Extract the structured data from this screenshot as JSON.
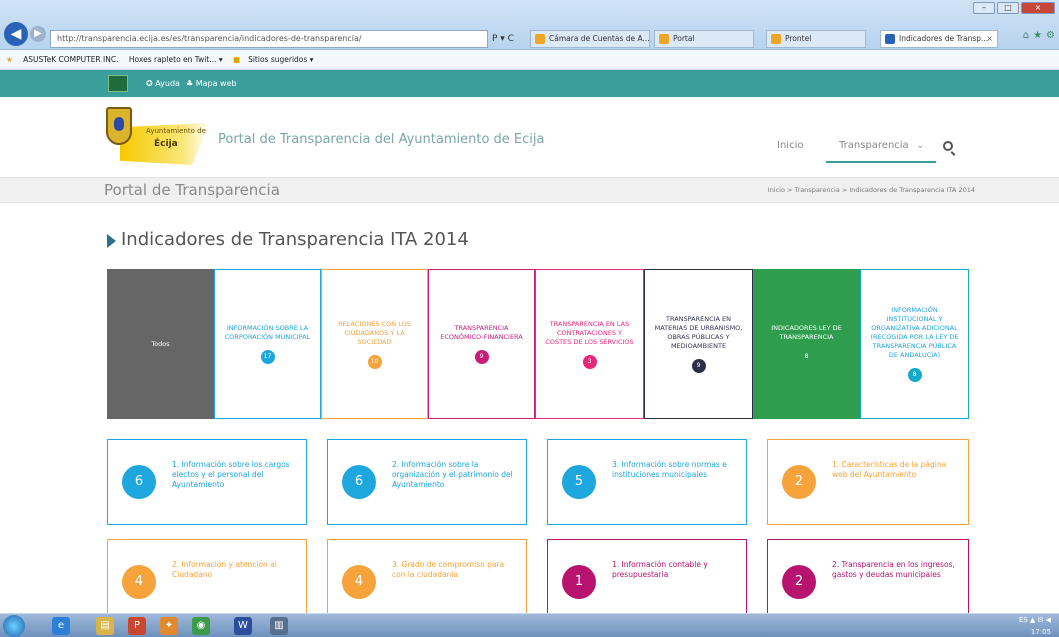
{
  "browser": {
    "address": "http://transparencia.ecija.es/es/transparencia/indicadores-de-transparencia/",
    "addr_tools": "P ▾ C",
    "tabs": [
      {
        "label": "Cámara de Cuentas de A..."
      },
      {
        "label": "Portal"
      },
      {
        "label": "Prontel"
      },
      {
        "label": "Indicadores de Transp...",
        "close": "×"
      }
    ],
    "window_controls": [
      "–",
      "□",
      "×"
    ],
    "tool_icons": [
      "⌂",
      "★",
      "⚙"
    ],
    "favorites": [
      "ASUSTeK COMPUTER INC.",
      "Hoxes rapleto en Twit... ▾",
      "Sitios sugeridos ▾"
    ],
    "fav_star": "★"
  },
  "site": {
    "topbar": {
      "help": "✪ Ayuda",
      "sitemap": "♣ Mapa web"
    },
    "crest_caption": "Ayuntamiento de",
    "crest_name": "Écija",
    "portal_title": "Portal de Transparencia del Ayuntamiento de Ecija",
    "nav": {
      "home": "Inicio",
      "transparency": "Transparencia",
      "chevron": "⌄"
    },
    "page_title": "Portal de Transparencia",
    "breadcrumb": "Inicio  >  Transparencia  >  Indicadores de Transparencia ITA 2014",
    "section_title": "Indicadores de Transparencia ITA 2014"
  },
  "categories": [
    {
      "label": "Todos",
      "badge": "",
      "text_color": "#ffffff",
      "bg": "#666666",
      "badge_color": ""
    },
    {
      "label": "INFORMACIÓN SOBRE LA CORPORACIÓN MUNICIPAL",
      "badge": "17",
      "text_color": "#1ea6de",
      "bg": "#ffffff",
      "badge_color": "#1ea6de"
    },
    {
      "label": "RELACIONES CON LOS CIUDADANOS Y LA SOCIEDAD",
      "badge": "10",
      "text_color": "#f5a33a",
      "bg": "#ffffff",
      "badge_color": "#f5a33a"
    },
    {
      "label": "TRANSPARENCIA ECONÓMICO-FINANCIERA",
      "badge": "9",
      "text_color": "#c81d7a",
      "bg": "#ffffff",
      "badge_color": "#c81d7a"
    },
    {
      "label": "TRANSPARENCIA EN LAS CONTRATACIONES Y COSTES DE LOS SERVICIOS",
      "badge": "3",
      "text_color": "#e8287a",
      "bg": "#ffffff",
      "badge_color": "#e8287a"
    },
    {
      "label": "TRANSPARENCIA EN MATERIAS DE URBANISMO, OBRAS PÚBLICAS Y MEDIOAMBIENTE",
      "badge": "9",
      "text_color": "#333355",
      "bg": "#ffffff",
      "badge_color": "#2d2f4a"
    },
    {
      "label": "INDICADORES LEY DE TRANSPARENCIA",
      "badge": "8",
      "text_color": "#ffffff",
      "bg": "#2e9e4e",
      "badge_color": "#2e9e4e"
    },
    {
      "label": "INFORMACIÓN INSTITUCIONAL Y ORGANIZATIVA ADICIONAL (RECOGIDA POR LA LEY DE TRANSPARENCIA PÚBLICA DE ANDALUCÍA)",
      "badge": "8",
      "text_color": "#1ea6de",
      "bg": "#ffffff",
      "badge_color": "#17a9c9"
    }
  ],
  "cards": [
    {
      "count": "6",
      "title": "1. Información sobre los cargos electos y el personal del Ayuntamiento",
      "color": "#1ea6de"
    },
    {
      "count": "6",
      "title": "2. Información sobre la organización y el patrimonio del Ayuntamiento",
      "color": "#1ea6de"
    },
    {
      "count": "5",
      "title": "3. Información sobre normas e instituciones municipales",
      "color": "#1ea6de"
    },
    {
      "count": "2",
      "title": "1. Características de la página web del Ayuntamiento",
      "color": "#f5a33a"
    },
    {
      "count": "4",
      "title": "2. Información y atención al Ciudadano",
      "color": "#f5a33a"
    },
    {
      "count": "4",
      "title": "3. Grado de compromiso para con la ciudadanía",
      "color": "#f5a33a"
    },
    {
      "count": "1",
      "title": "1. Información contable y presupuestaria",
      "color": "#b8136e"
    },
    {
      "count": "2",
      "title": "2. Transparencia en los ingresos, gastos y deudas municipales",
      "color": "#b8136e"
    }
  ],
  "taskbar": {
    "apps": [
      "e",
      "▤",
      "P",
      "✦",
      "◉",
      "W",
      "▥"
    ],
    "tray": "ES ▲ ✉ ◀",
    "clock": "17:05"
  }
}
